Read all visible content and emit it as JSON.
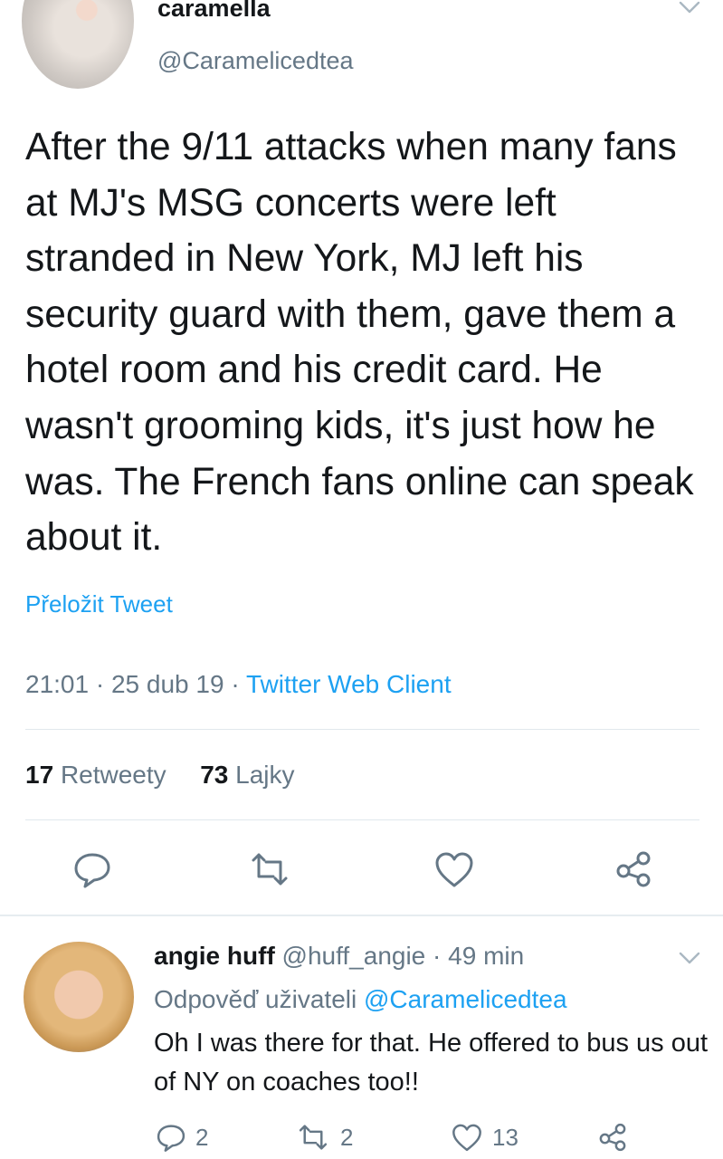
{
  "tweet": {
    "display_name": "caramella",
    "handle": "@Caramelicedtea",
    "text": "After the 9/11 attacks when many fans at MJ's MSG concerts were left stranded in New York, MJ left his security guard with them, gave them a hotel room and his credit card. He wasn't grooming kids, it's just how he was. The French fans online can speak about it.",
    "translate_label": "Přeložit Tweet",
    "time": "21:01",
    "date": "25 dub 19",
    "client": "Twitter Web Client",
    "retweet_count": "17",
    "retweet_label": "Retweety",
    "like_count": "73",
    "like_label": "Lajky"
  },
  "reply": {
    "display_name": "angie huff",
    "handle": "@huff_angie",
    "age": "49 min",
    "reply_to_label": "Odpověď uživateli",
    "reply_to_handle": "@Caramelicedtea",
    "text": "Oh I was there for that. He offered to bus us out of NY on coaches too!!",
    "reply_count": "2",
    "retweet_count": "2",
    "like_count": "13"
  },
  "colors": {
    "accent": "#1da1f2",
    "secondary_text": "#657786",
    "primary_text": "#14171a",
    "divider": "#e1e8ed"
  },
  "icons": [
    "chevron-down-icon",
    "reply-icon",
    "retweet-icon",
    "like-icon",
    "share-icon"
  ]
}
